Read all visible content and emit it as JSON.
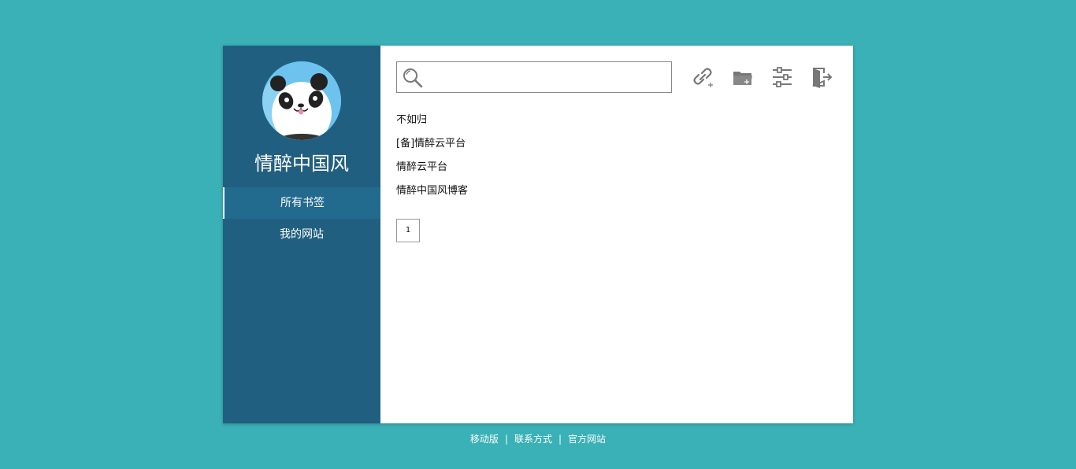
{
  "sidebar": {
    "title": "情醉中国风",
    "nav": [
      {
        "label": "所有书签",
        "active": true
      },
      {
        "label": "我的网站",
        "active": false
      }
    ]
  },
  "search": {
    "placeholder": "",
    "value": ""
  },
  "toolbar": {
    "icons": [
      "add-link-icon",
      "add-folder-icon",
      "settings-sliders-icon",
      "logout-icon"
    ]
  },
  "bookmarks": [
    "不如归",
    "[备]情醉云平台",
    "情醉云平台",
    "情醉中国风博客"
  ],
  "pagination": {
    "current": "1"
  },
  "footer": {
    "links": [
      "移动版",
      "联系方式",
      "官方网站"
    ],
    "separator": "|"
  },
  "colors": {
    "background": "#3ab1b7",
    "sidebar": "#215f80",
    "sidebar_active": "#236a8f",
    "icon": "#777777"
  }
}
